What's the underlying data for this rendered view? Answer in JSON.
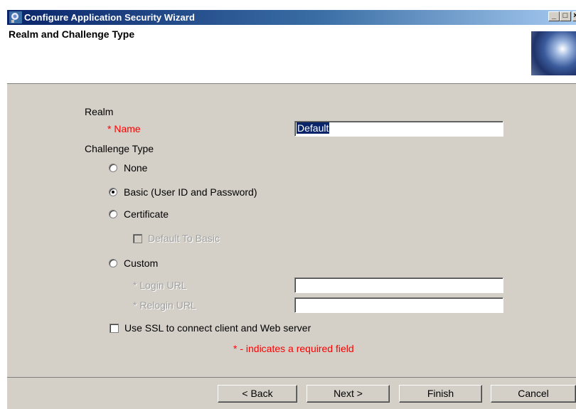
{
  "window": {
    "title": "Configure Application Security Wizard",
    "min_glyph": "_",
    "max_glyph": "□",
    "close_glyph": "×"
  },
  "header": {
    "title": "Realm and Challenge Type"
  },
  "form": {
    "realm_label": "Realm",
    "name_label": "* Name",
    "name_value": "Default",
    "challenge_label": "Challenge Type",
    "options": {
      "none": "None",
      "basic": "Basic (User ID and Password)",
      "certificate": "Certificate",
      "default_to_basic": "Default To Basic",
      "custom": "Custom"
    },
    "selected_option": "basic",
    "login_url_label": "* Login URL",
    "login_url_value": "",
    "relogin_url_label": "* Relogin URL",
    "relogin_url_value": "",
    "ssl_label": "Use SSL to connect client and Web server",
    "ssl_checked": false,
    "required_note": "* - indicates a required field"
  },
  "buttons": {
    "back": "< Back",
    "next": "Next >",
    "finish": "Finish",
    "cancel": "Cancel"
  },
  "colors": {
    "required": "#ff0000",
    "panel": "#d4d0c8",
    "titlebar": "#0a246a"
  }
}
